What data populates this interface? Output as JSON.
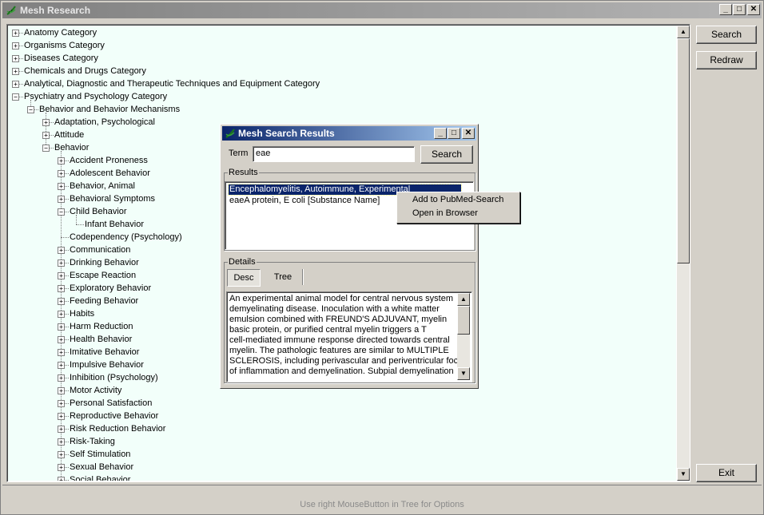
{
  "window": {
    "title": "Mesh Research",
    "controls": [
      "_",
      "□",
      "✕"
    ]
  },
  "side_buttons": {
    "search": "Search",
    "redraw": "Redraw",
    "exit": "Exit"
  },
  "status_text": "Use right MouseButton in Tree for Options",
  "tree": [
    {
      "label": "Anatomy Category",
      "depth": 0,
      "expander": "+"
    },
    {
      "label": "Organisms Category",
      "depth": 0,
      "expander": "+"
    },
    {
      "label": "Diseases Category",
      "depth": 0,
      "expander": "+"
    },
    {
      "label": "Chemicals and Drugs Category",
      "depth": 0,
      "expander": "+"
    },
    {
      "label": "Analytical, Diagnostic and Therapeutic Techniques and Equipment Category",
      "depth": 0,
      "expander": "+"
    },
    {
      "label": "Psychiatry and Psychology Category",
      "depth": 0,
      "expander": "-"
    },
    {
      "label": "Behavior and Behavior Mechanisms",
      "depth": 1,
      "expander": "-"
    },
    {
      "label": "Adaptation, Psychological",
      "depth": 2,
      "expander": "+"
    },
    {
      "label": "Attitude",
      "depth": 2,
      "expander": "+"
    },
    {
      "label": "Behavior",
      "depth": 2,
      "expander": "-"
    },
    {
      "label": "Accident Proneness",
      "depth": 3,
      "expander": "+"
    },
    {
      "label": "Adolescent Behavior",
      "depth": 3,
      "expander": "+"
    },
    {
      "label": "Behavior, Animal",
      "depth": 3,
      "expander": "+"
    },
    {
      "label": "Behavioral Symptoms",
      "depth": 3,
      "expander": "+"
    },
    {
      "label": "Child Behavior",
      "depth": 3,
      "expander": "-"
    },
    {
      "label": "Infant Behavior",
      "depth": 4,
      "expander": ""
    },
    {
      "label": "Codependency (Psychology)",
      "depth": 3,
      "expander": ""
    },
    {
      "label": "Communication",
      "depth": 3,
      "expander": "+"
    },
    {
      "label": "Drinking Behavior",
      "depth": 3,
      "expander": "+"
    },
    {
      "label": "Escape Reaction",
      "depth": 3,
      "expander": "+"
    },
    {
      "label": "Exploratory Behavior",
      "depth": 3,
      "expander": "+"
    },
    {
      "label": "Feeding Behavior",
      "depth": 3,
      "expander": "+"
    },
    {
      "label": "Habits",
      "depth": 3,
      "expander": "+"
    },
    {
      "label": "Harm Reduction",
      "depth": 3,
      "expander": "+"
    },
    {
      "label": "Health Behavior",
      "depth": 3,
      "expander": "+"
    },
    {
      "label": "Imitative Behavior",
      "depth": 3,
      "expander": "+"
    },
    {
      "label": "Impulsive Behavior",
      "depth": 3,
      "expander": "+"
    },
    {
      "label": "Inhibition (Psychology)",
      "depth": 3,
      "expander": "+"
    },
    {
      "label": "Motor Activity",
      "depth": 3,
      "expander": "+"
    },
    {
      "label": "Personal Satisfaction",
      "depth": 3,
      "expander": "+"
    },
    {
      "label": "Reproductive Behavior",
      "depth": 3,
      "expander": "+"
    },
    {
      "label": "Risk Reduction Behavior",
      "depth": 3,
      "expander": "+"
    },
    {
      "label": "Risk-Taking",
      "depth": 3,
      "expander": "+"
    },
    {
      "label": "Self Stimulation",
      "depth": 3,
      "expander": "+"
    },
    {
      "label": "Sexual Behavior",
      "depth": 3,
      "expander": "+"
    },
    {
      "label": "Social Behavior",
      "depth": 3,
      "expander": "+"
    }
  ],
  "dialog": {
    "title": "Mesh Search Results",
    "term_label": "Term",
    "term_value": "eae",
    "search_button": "Search",
    "results_label": "Results",
    "results": [
      {
        "text": "Encephalomyelitis, Autoimmune, Experimental",
        "selected": true
      },
      {
        "text": "eaeA protein, E coli [Substance Name]",
        "selected": false
      }
    ],
    "details_label": "Details",
    "tabs": [
      {
        "label": "Desc",
        "active": true
      },
      {
        "label": "Tree",
        "active": false
      }
    ],
    "description_lines": [
      "An experimental animal model for central nervous system",
      "demyelinating disease. Inoculation with a white matter",
      "emulsion combined with FREUND'S ADJUVANT, myelin",
      "basic protein, or purified central myelin triggers a T",
      "cell-mediated immune response directed towards central",
      "myelin. The pathologic features are similar to MULTIPLE",
      "SCLEROSIS, including perivascular and periventricular foci",
      "of inflammation and demyelination. Subpial demyelination"
    ]
  },
  "context_menu": {
    "items": [
      "Add to PubMed-Search",
      "Open in Browser"
    ]
  }
}
